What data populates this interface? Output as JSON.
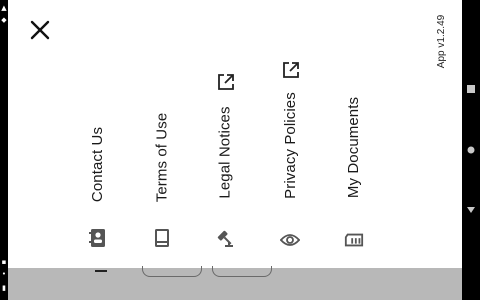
{
  "app": {
    "version_label": "App v1.2.49"
  },
  "menu": {
    "close_icon": "close-icon",
    "items": [
      {
        "label": "Contact Us",
        "icon": "contact-card-icon",
        "external": false
      },
      {
        "label": "Terms of Use",
        "icon": "book-icon",
        "external": false
      },
      {
        "label": "Legal Notices",
        "icon": "gavel-icon",
        "external": true
      },
      {
        "label": "Privacy Policies",
        "icon": "eye-icon",
        "external": true
      },
      {
        "label": "My Documents",
        "icon": "document-icon",
        "external": false
      }
    ]
  },
  "system_nav": {
    "buttons": [
      "recents-icon",
      "home-icon",
      "back-icon"
    ]
  },
  "colors": {
    "background": "#ffffff",
    "text": "#1a1a1a",
    "icon": "#555555",
    "sheet": "#b8b8b8"
  }
}
